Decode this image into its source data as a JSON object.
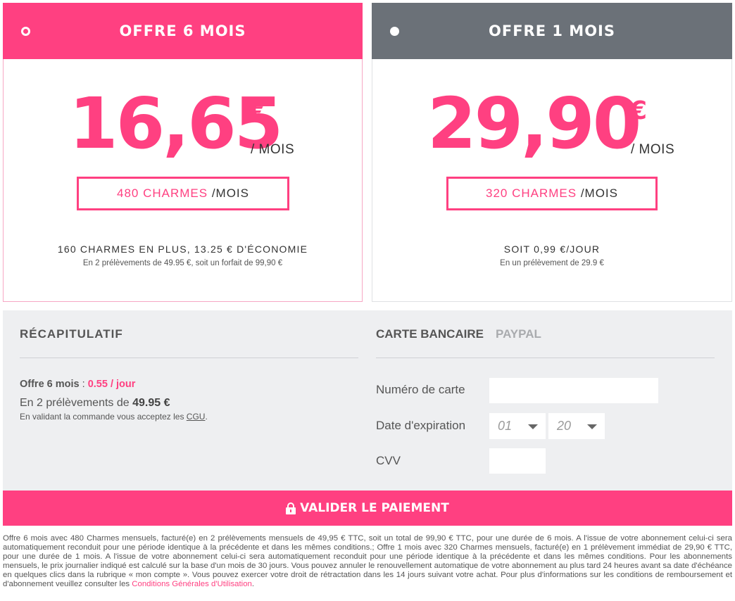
{
  "plans": {
    "six": {
      "title": "OFFRE 6 MOIS",
      "price": "16,65",
      "currency": "€",
      "unit": "/ MOIS",
      "charms_amount": "480 CHARMES",
      "charms_unit": "/MOIS",
      "line1": "160 CHARMES EN PLUS, 13.25 € D'ÉCONOMIE",
      "line2": "En 2 prélèvements de 49.95 €, soit un forfait de 99,90 €",
      "selected": true
    },
    "one": {
      "title": "OFFRE 1 MOIS",
      "price": "29,90",
      "currency": "€",
      "unit": "/ MOIS",
      "charms_amount": "320 CHARMES",
      "charms_unit": "/MOIS",
      "line1": "SOIT 0,99 €/JOUR",
      "line2": "En un prélèvement de 29.9 €",
      "selected": false
    }
  },
  "recap": {
    "title": "RÉCAPITULATIF",
    "offer_name": "Offre 6 mois",
    "separator": " : ",
    "offer_rate": "0.55 / jour",
    "line_prefix": "En 2 prélèvements de ",
    "line_amount": "49.95 €",
    "cgu_prefix": "En validant la commande vous acceptez les ",
    "cgu_link": "CGU",
    "cgu_suffix": "."
  },
  "payment": {
    "tabs": [
      {
        "label": "CARTE BANCAIRE",
        "active": true
      },
      {
        "label": "PAYPAL",
        "active": false
      }
    ],
    "card_number_label": "Numéro de carte",
    "card_number_value": "",
    "expiry_label": "Date d'expiration",
    "expiry_month": "01",
    "expiry_year": "20",
    "cvv_label": "CVV",
    "cvv_value": ""
  },
  "submit": {
    "label": "VALIDER LE PAIEMENT"
  },
  "legal": {
    "text": "Offre 6 mois avec 480 Charmes mensuels, facturé(e) en 2 prélèvements mensuels de 49,95 € TTC, soit un total de 99,90 € TTC, pour une durée de 6 mois. A l'issue de votre abonnement celui-ci sera automatiquement reconduit pour une période identique à la précédente et dans les mêmes conditions.; Offre 1 mois avec 320 Charmes mensuels, facturé(e) en 1 prélèvement immédiat de 29,90 € TTC, pour une durée de 1 mois. A l'issue de votre abonnement celui-ci sera automatiquement reconduit pour une période identique à la précédente et dans les mêmes conditions. Pour les abonnements mensuels, le prix journalier indiqué est calculé sur la base d'un mois de 30 jours. Vous pouvez annuler le renouvellement automatique de votre abonnement au plus tard 24 heures avant sa date d'échéance en quelques clics dans la rubrique « mon compte ». Vous pouvez exercer votre droit de rétractation dans les 14 jours suivant votre achat. Pour plus d'informations sur les conditions de remboursement et d'abonnement veuillez consulter les ",
    "link": "Conditions Générales d'Utilisation",
    "suffix": "."
  },
  "colors": {
    "accent": "#ff4081",
    "inactive_header": "#6b7178",
    "panel_bg": "#eeeff1"
  }
}
